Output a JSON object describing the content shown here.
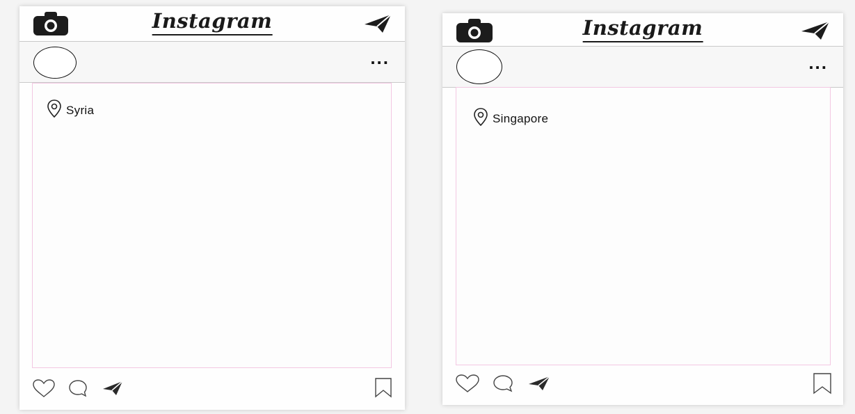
{
  "posts": [
    {
      "brand": "Instagram",
      "location": "Syria",
      "icons": [
        "camera-icon",
        "paper-plane-icon",
        "more-icon",
        "location-pin-icon",
        "heart-icon",
        "comment-icon",
        "share-icon",
        "bookmark-icon"
      ]
    },
    {
      "brand": "Instagram",
      "location": "Singapore",
      "icons": [
        "camera-icon",
        "paper-plane-icon",
        "more-icon",
        "location-pin-icon",
        "heart-icon",
        "comment-icon",
        "share-icon",
        "bookmark-icon"
      ]
    }
  ],
  "colors": {
    "photo_border": "#f3c7e2",
    "ink": "#111111",
    "card": "#fefefe",
    "background": "#f4f4f4"
  },
  "more_glyph": "..."
}
